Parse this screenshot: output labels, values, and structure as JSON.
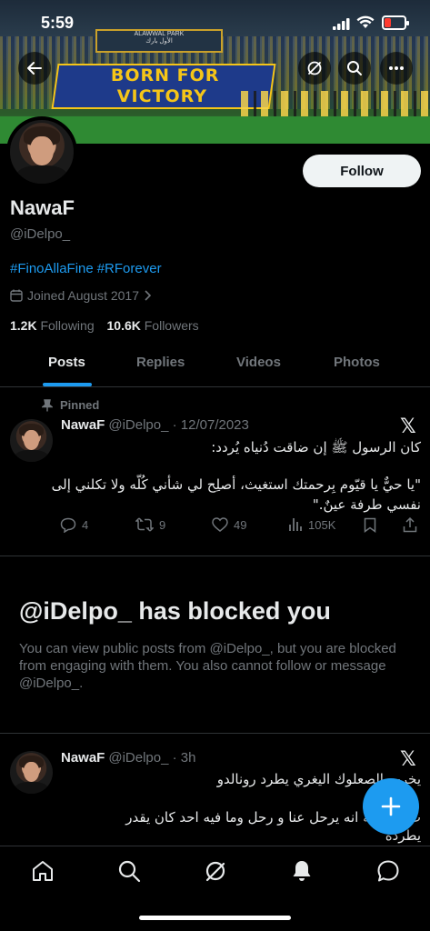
{
  "status_bar": {
    "time": "5:59"
  },
  "banner": {
    "tifo_line1": "BORN FOR",
    "tifo_line2": "VICTORY",
    "sign_left": "ALAWWAL PARK",
    "sign_right": "الأول بارك"
  },
  "profile": {
    "display_name": "NawaF",
    "handle": "@iDelpo_",
    "hashtags": [
      "#FinoAllaFine",
      "#RForever"
    ],
    "joined": "Joined August 2017",
    "following_count": "1.2K",
    "following_label": "Following",
    "followers_count": "10.6K",
    "followers_label": "Followers",
    "follow_button": "Follow"
  },
  "tabs": [
    "Posts",
    "Replies",
    "Videos",
    "Photos"
  ],
  "pinned_tweet": {
    "pinned_label": "Pinned",
    "name": "NawaF",
    "handle_date": "@iDelpo_ · 12/07/2023",
    "line1": "كان الرسول ﷺ إن ضاقت دُنياه يُردد:",
    "line2": "\"يا حيٌّ يا قيّوم بِرحمتك استغيث، أصلِح لي شأني كُلّه ولا تكلني إلى",
    "line3": "نفسي طرفة عينٌ.\"",
    "replies": "4",
    "retweets": "9",
    "likes": "49",
    "views": "105K"
  },
  "blocked": {
    "title": "@iDelpo_ has blocked you",
    "text": "You can view public posts from @iDelpo_, but you are blocked from engaging with them. You also cannot follow or message @iDelpo_."
  },
  "second_tweet": {
    "name": "NawaF",
    "handle_time": "@iDelpo_ · 3h",
    "line1": "يخرب الصعلوك اليغري يطرد رونالدو",
    "line2": "ت له رغبة انه يرحل عنا و رحل وما فيه احد كان يقدر",
    "line3": "يطرده"
  },
  "colors": {
    "accent": "#1d9bf0",
    "background": "#000000",
    "muted": "#71767b"
  }
}
